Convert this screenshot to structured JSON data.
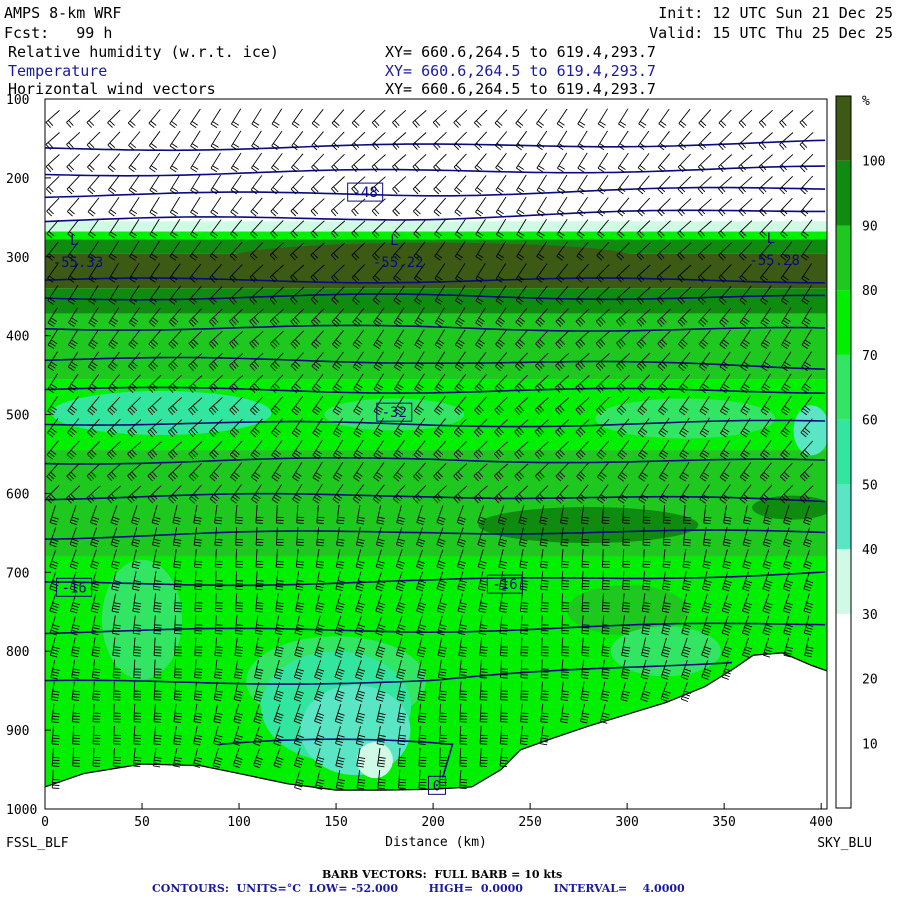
{
  "header": {
    "model": "AMPS 8-km WRF",
    "fcst": "Fcst:   99 h",
    "init": "Init: 12 UTC Sun 21 Dec 25",
    "valid": "Valid: 15 UTC Thu 25 Dec 25",
    "fields": [
      {
        "name": "Relative humidity (w.r.t. ice)",
        "xy": "XY= 660.6,264.5 to 619.4,293.7"
      },
      {
        "name": "Temperature",
        "xy": "XY= 660.6,264.5 to 619.4,293.7"
      },
      {
        "name": "Horizontal wind vectors",
        "xy": "XY= 660.6,264.5 to 619.4,293.7"
      }
    ]
  },
  "footer": {
    "barb": "BARB VECTORS:  FULL BARB = 10 kts",
    "contours": "CONTOURS:  UNITS=°C  LOW= -52.000        HIGH=  0.0000        INTERVAL=    4.0000"
  },
  "chart_data": {
    "type": "heatmap",
    "xlabel": "Distance (km)",
    "x_ticks": [
      0,
      50,
      100,
      150,
      200,
      250,
      300,
      350,
      400
    ],
    "xlim": [
      0,
      403
    ],
    "y_ticks": [
      100,
      200,
      300,
      400,
      500,
      600,
      700,
      800,
      900,
      1000
    ],
    "ylim": [
      1000,
      100
    ],
    "left_label": "FSSL_BLF",
    "right_label": "SKY_BLU",
    "colorbar": {
      "unit": "%",
      "ticks": [
        10,
        20,
        30,
        40,
        50,
        60,
        70,
        80,
        90,
        100
      ],
      "colors": [
        "#ffffff",
        "#ffffff",
        "#d0fae6",
        "#5ae6c4",
        "#32e6a0",
        "#32e664",
        "#00f000",
        "#1ec81e",
        "#0f8c0f",
        "#3c5a14"
      ]
    },
    "temperature_contours": {
      "levels": [
        -52,
        -48,
        -44,
        -40,
        -36,
        -32,
        -28,
        -24,
        -20,
        -16,
        -12,
        -8,
        -4,
        0
      ],
      "labels": [
        {
          "text": "-48",
          "x": 165,
          "p": 218
        },
        {
          "text": "-32",
          "x": 180,
          "p": 497
        },
        {
          "text": "-16",
          "x": 15,
          "p": 719
        },
        {
          "text": "-16",
          "x": 237,
          "p": 715
        },
        {
          "text": "0",
          "x": 202,
          "p": 970
        }
      ],
      "extrema": [
        {
          "type": "L",
          "value": "-55.33",
          "x": 17,
          "p": 300
        },
        {
          "type": "L",
          "value": "-55.22",
          "x": 182,
          "p": 300
        },
        {
          "type": "L",
          "value": "-55.28",
          "x": 376,
          "p": 298
        }
      ]
    },
    "terrain_surface": [
      {
        "x": 0,
        "p": 972
      },
      {
        "x": 20,
        "p": 955
      },
      {
        "x": 50,
        "p": 943
      },
      {
        "x": 80,
        "p": 945
      },
      {
        "x": 100,
        "p": 955
      },
      {
        "x": 125,
        "p": 968
      },
      {
        "x": 150,
        "p": 976
      },
      {
        "x": 175,
        "p": 976
      },
      {
        "x": 200,
        "p": 975
      },
      {
        "x": 220,
        "p": 972
      },
      {
        "x": 235,
        "p": 950
      },
      {
        "x": 245,
        "p": 925
      },
      {
        "x": 262,
        "p": 910
      },
      {
        "x": 280,
        "p": 895
      },
      {
        "x": 300,
        "p": 880
      },
      {
        "x": 320,
        "p": 865
      },
      {
        "x": 340,
        "p": 845
      },
      {
        "x": 355,
        "p": 822
      },
      {
        "x": 365,
        "p": 805
      },
      {
        "x": 380,
        "p": 802
      },
      {
        "x": 395,
        "p": 818
      },
      {
        "x": 403,
        "p": 825
      }
    ]
  }
}
